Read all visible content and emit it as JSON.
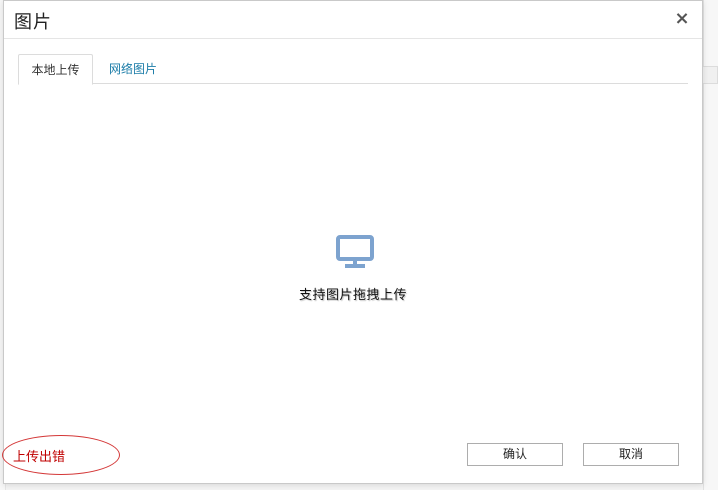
{
  "dialog": {
    "title": "图片",
    "close_glyph": "×"
  },
  "tabs": [
    {
      "label": "本地上传",
      "active": true
    },
    {
      "label": "网络图片",
      "active": false
    }
  ],
  "drop_area": {
    "icon": "monitor-icon",
    "text": "支持图片拖拽上传"
  },
  "footer": {
    "error_text": "上传出错",
    "confirm_label": "确认",
    "cancel_label": "取消"
  },
  "colors": {
    "tab_link": "#1b7ca8",
    "icon": "#7da3cf",
    "error": "#c00000"
  }
}
